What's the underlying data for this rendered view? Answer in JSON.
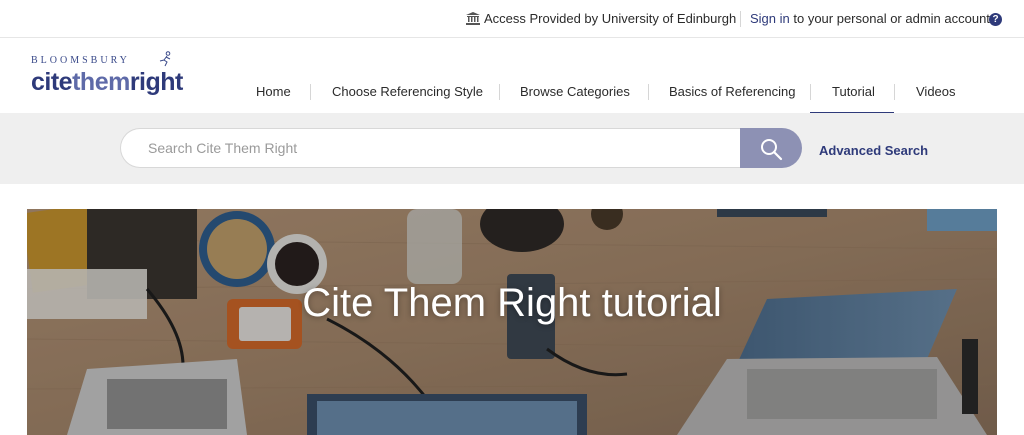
{
  "topbar": {
    "access_text": "Access Provided by University of Edinburgh",
    "signin_link": "Sign in",
    "signin_rest": " to your personal or admin account",
    "help_glyph": "?"
  },
  "logo": {
    "publisher": "BLOOMSBURY",
    "word_a": "cite",
    "word_b": "them",
    "word_c": "right"
  },
  "nav": {
    "items": [
      {
        "label": "Home"
      },
      {
        "label": "Choose Referencing Style"
      },
      {
        "label": "Browse Categories"
      },
      {
        "label": "Basics of Referencing"
      },
      {
        "label": "Tutorial",
        "active": true
      },
      {
        "label": "Videos"
      }
    ]
  },
  "search": {
    "placeholder": "Search Cite Them Right",
    "value": "",
    "advanced_label": "Advanced Search"
  },
  "hero": {
    "title": "Cite Them Right tutorial"
  },
  "colors": {
    "brand": "#2e3a7a",
    "search_button": "#8d91b4",
    "search_band": "#efefef"
  },
  "icons": [
    "institution-icon",
    "help-icon",
    "runner-logo-icon",
    "search-icon"
  ]
}
